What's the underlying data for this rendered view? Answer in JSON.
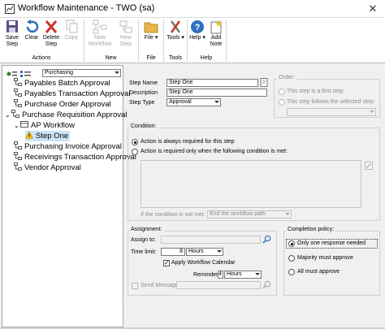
{
  "window": {
    "title": "Workflow Maintenance  -  TWO (sa)"
  },
  "ribbon": {
    "buttons": {
      "save": "Save\nStep",
      "clear": "Clear",
      "delete": "Delete\nStep",
      "copy": "Copy",
      "new_workflow": "New\nWorkflow",
      "new_step": "New\nStep",
      "file": "File",
      "tools": "Tools",
      "help": "Help",
      "add_note": "Add\nNote"
    },
    "groups": {
      "actions": "Actions",
      "new": "New",
      "file": "File",
      "tools": "Tools",
      "help": "Help"
    }
  },
  "tree": {
    "filter_value": "Purchasing",
    "items": [
      {
        "label": "Payables Batch Approval"
      },
      {
        "label": "Payables Transaction Approval"
      },
      {
        "label": "Purchase Order Approval"
      },
      {
        "label": "Purchase Requisition Approval"
      },
      {
        "label": "AP Workflow"
      },
      {
        "label": "Step One"
      },
      {
        "label": "Purchasing Invoice Approval"
      },
      {
        "label": "Receivings Transaction Approval"
      },
      {
        "label": "Vendor Approval"
      }
    ]
  },
  "step": {
    "name_label": "Step Name",
    "name_value": "Step One",
    "description_label": "Description",
    "description_value": "Step One",
    "type_label": "Step Type",
    "type_value": "Approval"
  },
  "order": {
    "title": "Order:",
    "first_step": "This step is a first step",
    "follows": "This step follows the selected step:"
  },
  "condition": {
    "title": "Condition:",
    "always": "Action is always required for this step",
    "only_when": "Action is required only when the following condition is met:",
    "not_met_label": "If the condition is not met:",
    "not_met_value": "End the workflow path"
  },
  "assignment": {
    "title": "Assignment:",
    "assign_to_label": "Assign to:",
    "time_limit_label": "Time limit:",
    "time_limit_value": "8",
    "time_limit_unit": "Hours",
    "apply_calendar": "Apply Workflow Calendar",
    "reminder_label": "Reminder:",
    "reminder_value": "4",
    "reminder_unit": "Hours",
    "send_message": "Send Message:"
  },
  "completion": {
    "title": "Completion policy:",
    "one_response": "Only one response needed",
    "majority": "Majority must approve",
    "all": "All must approve"
  }
}
